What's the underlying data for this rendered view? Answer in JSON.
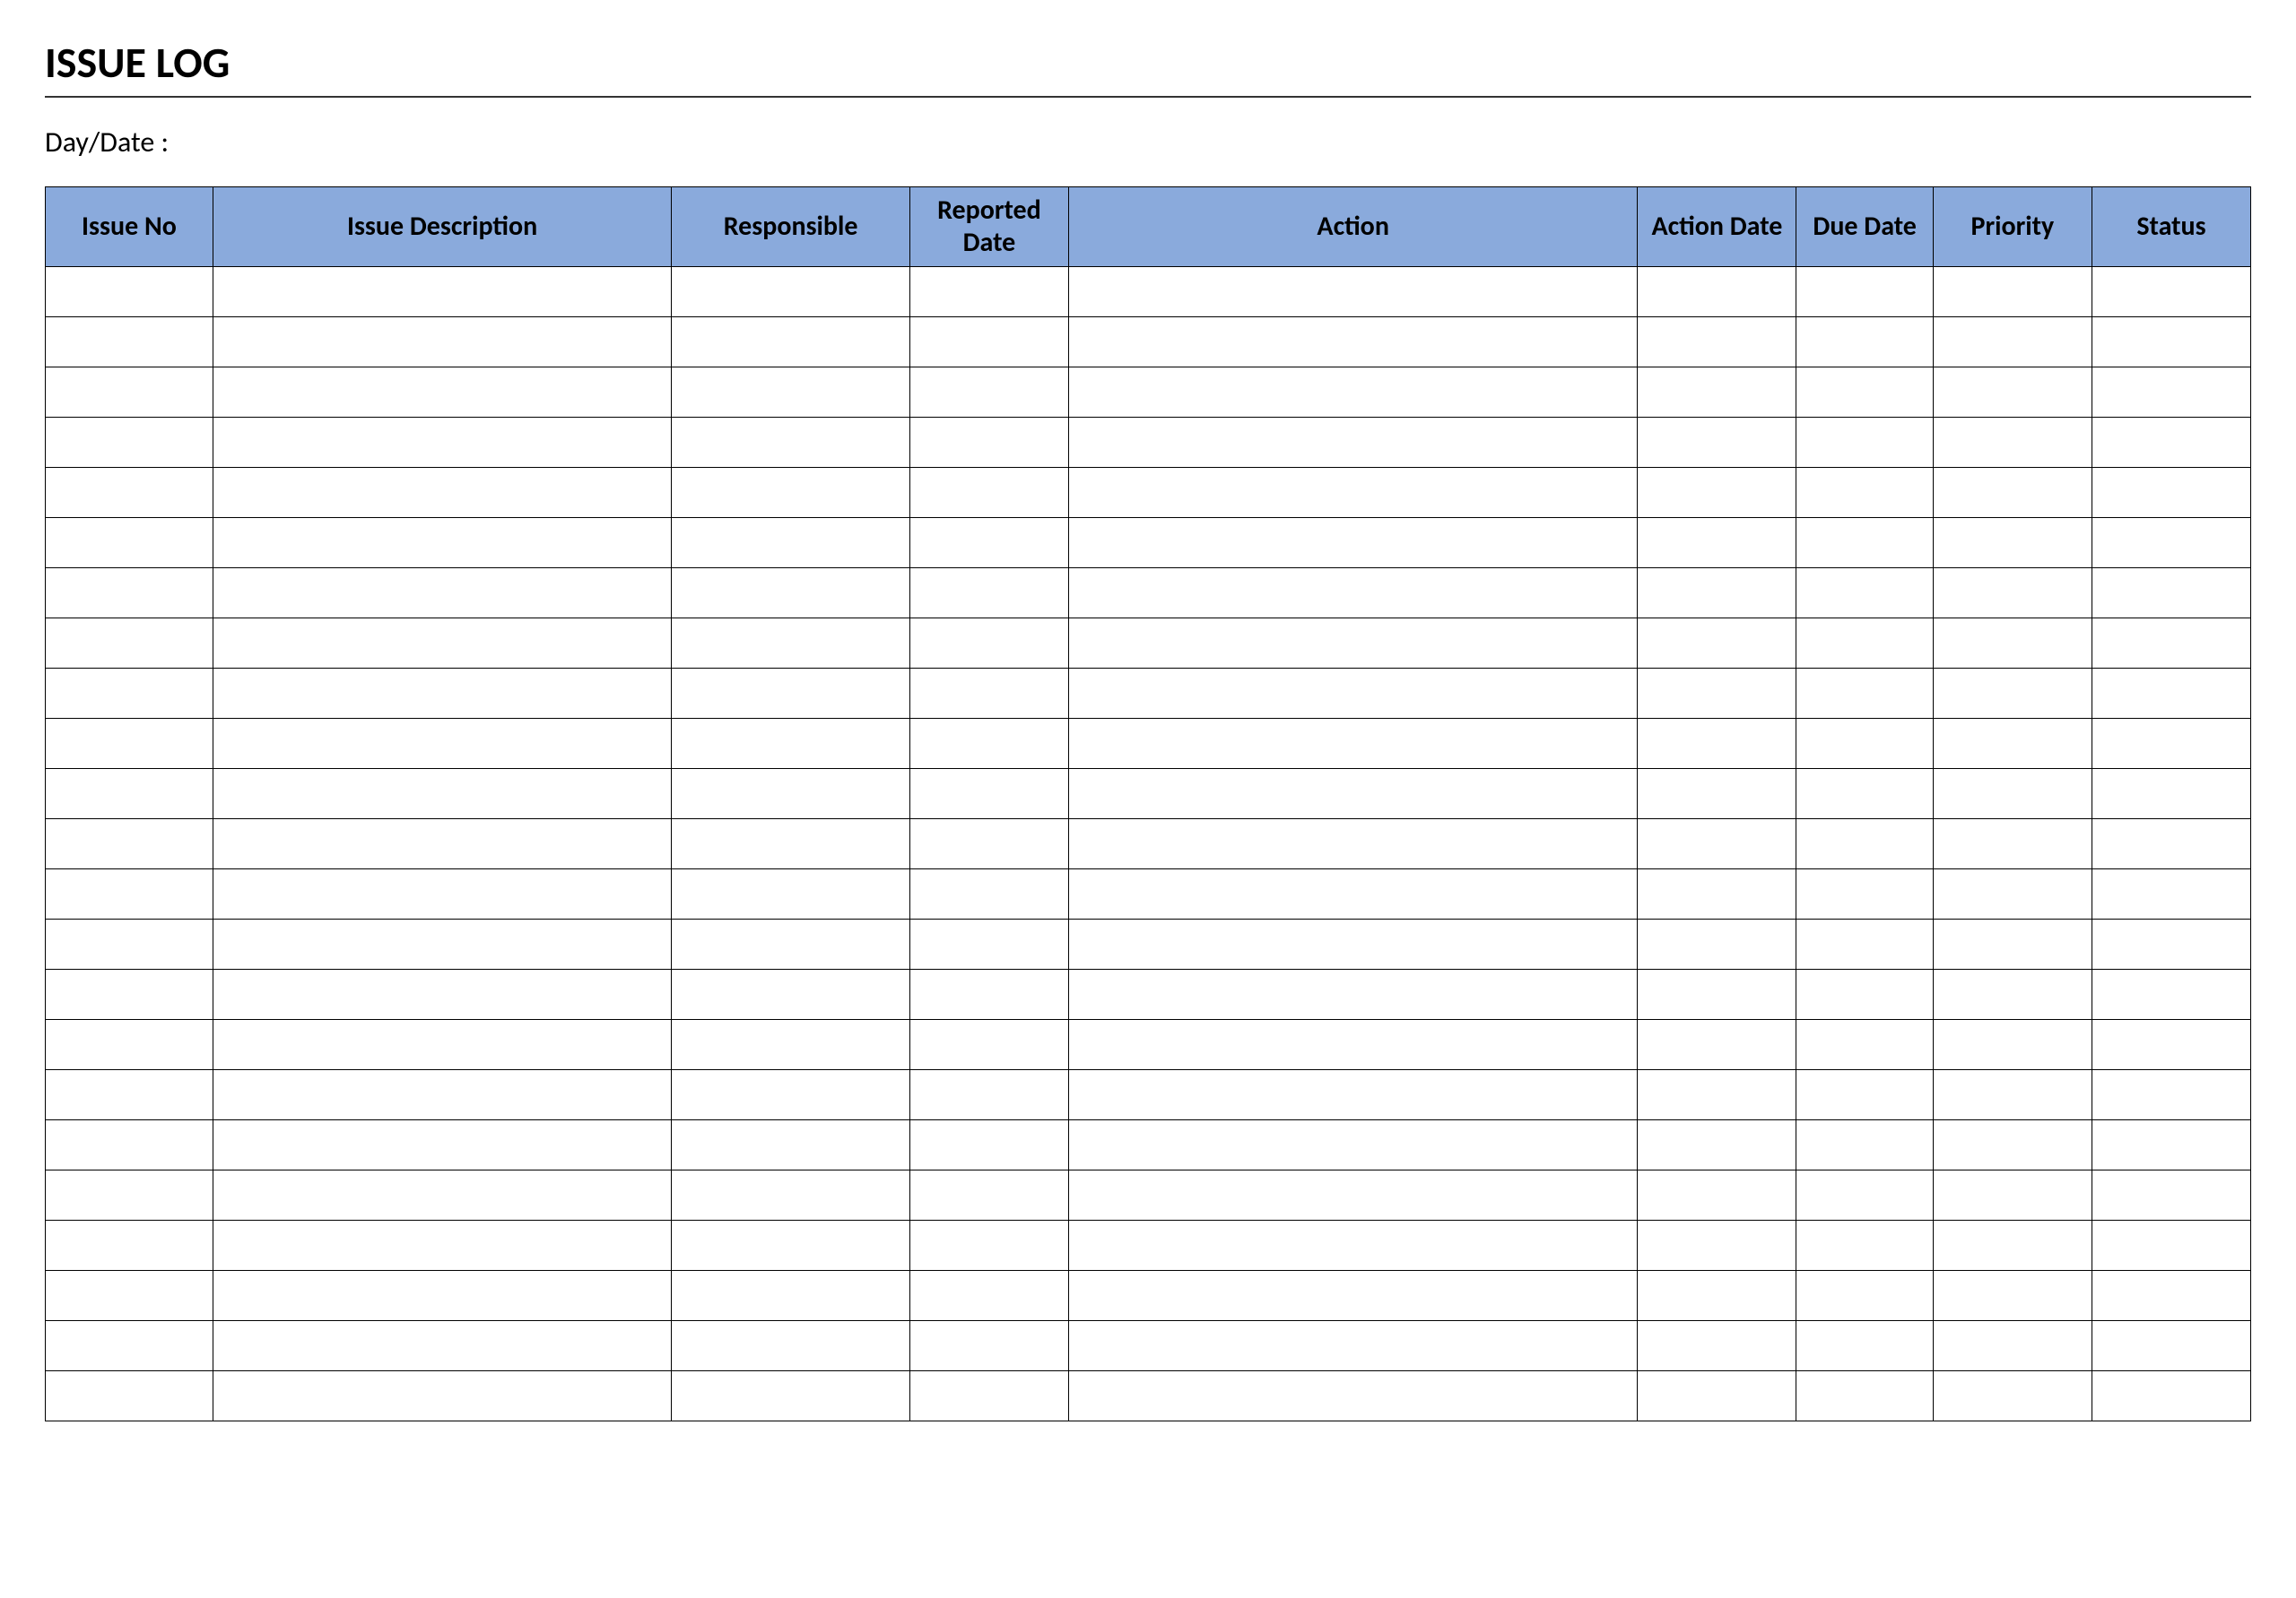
{
  "title": "ISSUE LOG",
  "daydate_label": "Day/Date :",
  "columns": [
    "Issue No",
    "Issue Description",
    "Responsible",
    "Reported Date",
    "Action",
    "Action Date",
    "Due Date",
    "Priority",
    "Status"
  ],
  "rows": [
    [
      "",
      "",
      "",
      "",
      "",
      "",
      "",
      "",
      ""
    ],
    [
      "",
      "",
      "",
      "",
      "",
      "",
      "",
      "",
      ""
    ],
    [
      "",
      "",
      "",
      "",
      "",
      "",
      "",
      "",
      ""
    ],
    [
      "",
      "",
      "",
      "",
      "",
      "",
      "",
      "",
      ""
    ],
    [
      "",
      "",
      "",
      "",
      "",
      "",
      "",
      "",
      ""
    ],
    [
      "",
      "",
      "",
      "",
      "",
      "",
      "",
      "",
      ""
    ],
    [
      "",
      "",
      "",
      "",
      "",
      "",
      "",
      "",
      ""
    ],
    [
      "",
      "",
      "",
      "",
      "",
      "",
      "",
      "",
      ""
    ],
    [
      "",
      "",
      "",
      "",
      "",
      "",
      "",
      "",
      ""
    ],
    [
      "",
      "",
      "",
      "",
      "",
      "",
      "",
      "",
      ""
    ],
    [
      "",
      "",
      "",
      "",
      "",
      "",
      "",
      "",
      ""
    ],
    [
      "",
      "",
      "",
      "",
      "",
      "",
      "",
      "",
      ""
    ],
    [
      "",
      "",
      "",
      "",
      "",
      "",
      "",
      "",
      ""
    ],
    [
      "",
      "",
      "",
      "",
      "",
      "",
      "",
      "",
      ""
    ],
    [
      "",
      "",
      "",
      "",
      "",
      "",
      "",
      "",
      ""
    ],
    [
      "",
      "",
      "",
      "",
      "",
      "",
      "",
      "",
      ""
    ],
    [
      "",
      "",
      "",
      "",
      "",
      "",
      "",
      "",
      ""
    ],
    [
      "",
      "",
      "",
      "",
      "",
      "",
      "",
      "",
      ""
    ],
    [
      "",
      "",
      "",
      "",
      "",
      "",
      "",
      "",
      ""
    ],
    [
      "",
      "",
      "",
      "",
      "",
      "",
      "",
      "",
      ""
    ],
    [
      "",
      "",
      "",
      "",
      "",
      "",
      "",
      "",
      ""
    ],
    [
      "",
      "",
      "",
      "",
      "",
      "",
      "",
      "",
      ""
    ],
    [
      "",
      "",
      "",
      "",
      "",
      "",
      "",
      "",
      ""
    ]
  ]
}
